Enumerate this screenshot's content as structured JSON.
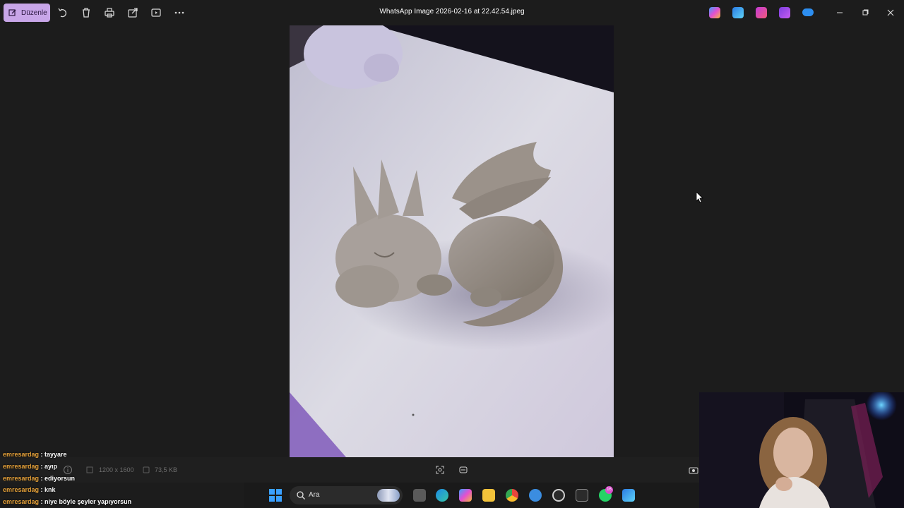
{
  "toolbar": {
    "edit_label": "Düzenle",
    "icons": [
      "rotate-icon",
      "delete-icon",
      "print-icon",
      "share-icon",
      "slideshow-icon",
      "more-icon"
    ]
  },
  "window": {
    "title": "WhatsApp Image 2026-02-16 at 22.42.54.jpeg",
    "app_icons": [
      "copilot-icon",
      "designer-icon",
      "clipchamp-icon",
      "video-editor-icon",
      "onedrive-icon"
    ],
    "controls": [
      "minimize-icon",
      "restore-icon",
      "close-icon"
    ]
  },
  "photo": {
    "subject": "clay dragon figurine"
  },
  "statusbar": {
    "dimensions": "1200 x 1600",
    "file_size": "73,5 KB"
  },
  "taskbar": {
    "search_placeholder": "Ara",
    "badge_count": "16",
    "apps": [
      "file-explorer-taskview-icon",
      "edge-icon",
      "copilot-icon",
      "folder-icon",
      "chrome-icon",
      "app-icon",
      "obs-icon",
      "terminal-icon",
      "whatsapp-icon",
      "paint-icon"
    ]
  },
  "chat": {
    "messages": [
      {
        "user": "emresardag",
        "text": "tayyare"
      },
      {
        "user": "emresardag",
        "text": "ayıp"
      },
      {
        "user": "emresardag",
        "text": "ediyorsun"
      },
      {
        "user": "emresardag",
        "text": "knk"
      },
      {
        "user": "emresardag",
        "text": "niye böyle şeyler yapıyorsun"
      }
    ],
    "separator": " : "
  },
  "colors": {
    "accent": "#c8a6e8",
    "background": "#1c1c1c",
    "chat_user": "#e8a33a"
  }
}
